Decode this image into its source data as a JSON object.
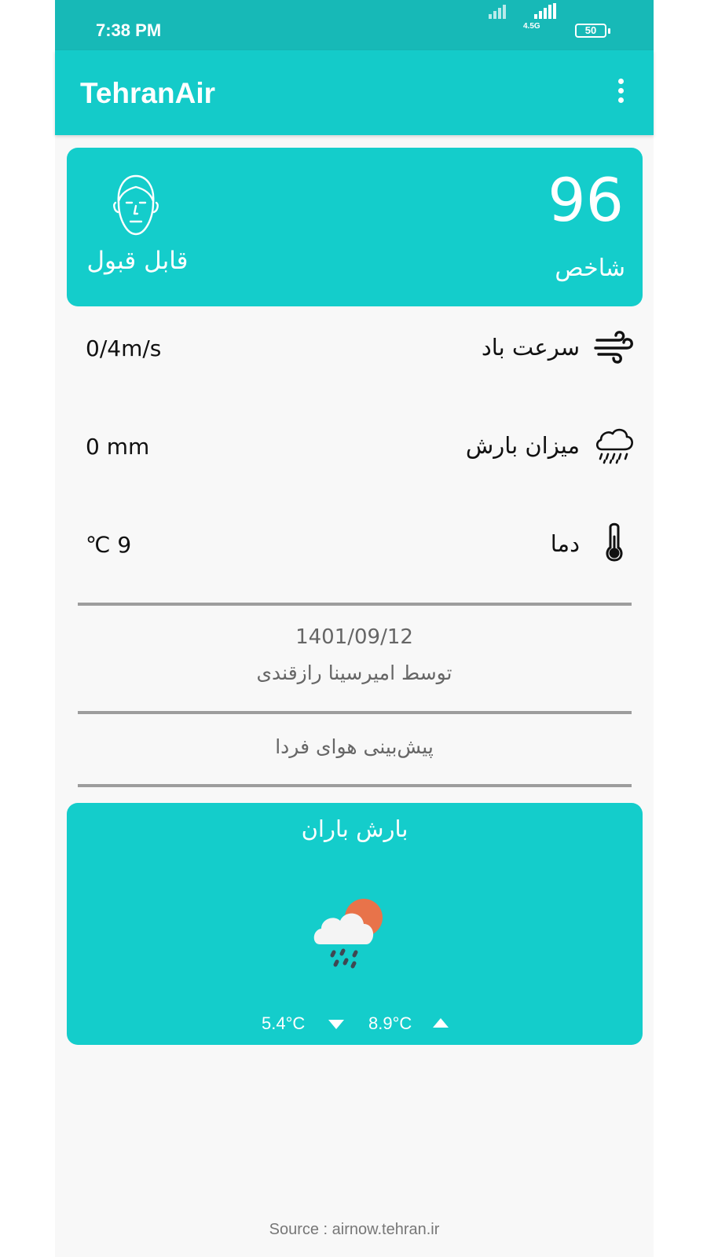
{
  "status_bar": {
    "time": "7:38 PM",
    "network": "4.5G",
    "battery": "50"
  },
  "app_bar": {
    "title": "TehranAir",
    "menu_icon": "more-vert-icon"
  },
  "aqi": {
    "value": "96",
    "label": "شاخص",
    "status": "قابل قبول",
    "icon": "neutral-face-icon"
  },
  "metrics": [
    {
      "label": "سرعت باد",
      "value": "0/4m/s",
      "icon": "wind-icon"
    },
    {
      "label": "میزان بارش",
      "value": "0 mm",
      "icon": "rain-cloud-icon"
    },
    {
      "label": "دما",
      "value": "℃ 9",
      "icon": "thermometer-icon"
    }
  ],
  "info": {
    "date": "1401/09/12",
    "author": "توسط امیرسینا رازقندی"
  },
  "forecast": {
    "heading": "پیش‌بینی هوای فردا",
    "condition": "بارش باران",
    "icon": "rain-sun-cloud-icon",
    "low": "5.4°C",
    "high": "8.9°C"
  },
  "footer": {
    "source": "Source : airnow.tehran.ir"
  },
  "colors": {
    "primary": "#14cbc9",
    "status_bar": "#17b9b7",
    "sun": "#e8734a"
  }
}
